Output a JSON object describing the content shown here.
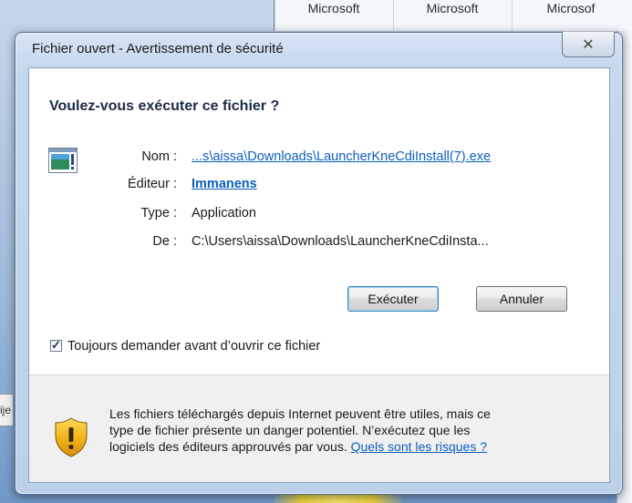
{
  "background": {
    "top_columns": [
      "Microsoft",
      "Microsoft",
      "Microsof"
    ],
    "left_tab": "ije"
  },
  "dialog": {
    "title": "Fichier ouvert - Avertissement de sécurité",
    "close_glyph": "✕",
    "heading": "Voulez-vous exécuter ce fichier ?",
    "fields": {
      "name_label": "Nom :",
      "name_value": "...s\\aissa\\Downloads\\LauncherKneCdiInstall(7).exe",
      "publisher_label": "Éditeur :",
      "publisher_value": "Immanens",
      "type_label": "Type :",
      "type_value": "Application",
      "from_label": "De :",
      "from_value": "C:\\Users\\aissa\\Downloads\\LauncherKneCdiInsta..."
    },
    "buttons": {
      "run": "Exécuter",
      "cancel": "Annuler"
    },
    "checkbox": {
      "label": "Toujours demander avant d’ouvrir ce fichier",
      "checked": true
    },
    "warning": {
      "line1": "Les fichiers téléchargés depuis Internet peuvent être utiles, mais ce",
      "line2": "type de fichier présente un danger potentiel. N’exécutez que les",
      "line3_prefix": "logiciels des éditeurs approuvés par vous. ",
      "risks_link": "Quels sont les risques ?"
    }
  },
  "colors": {
    "link": "#0b5fbf",
    "heading": "#1c2b46",
    "shield": "#f2b316"
  }
}
